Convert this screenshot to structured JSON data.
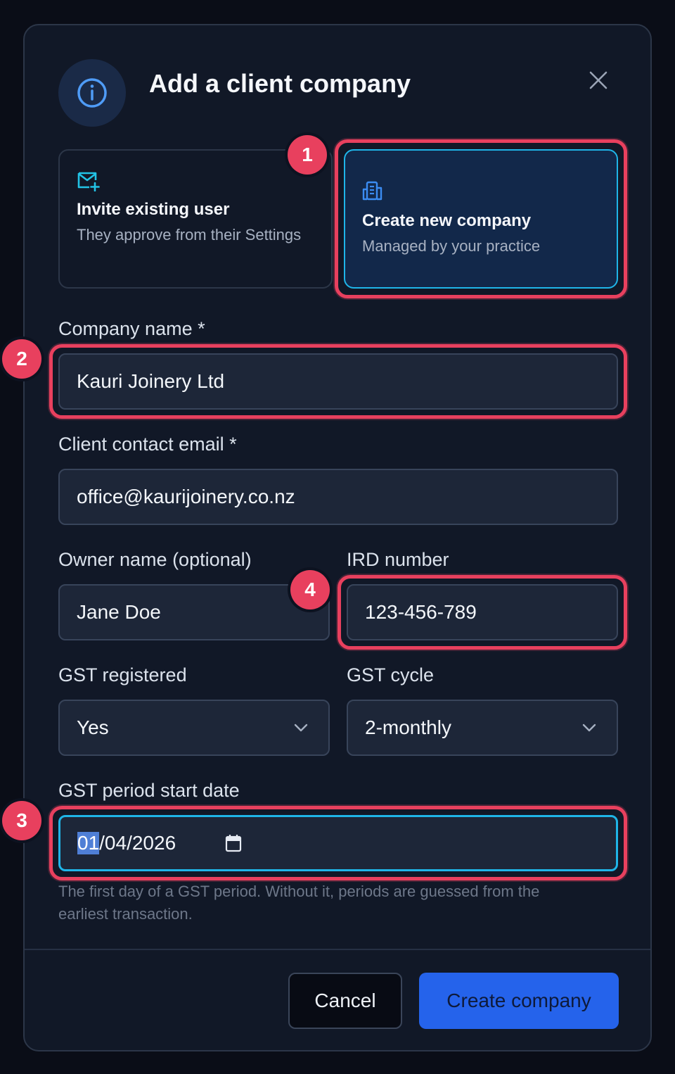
{
  "dialog": {
    "title": "Add a client company",
    "icons": {
      "header": "info-icon",
      "close": "close-icon"
    }
  },
  "options": {
    "invite": {
      "title": "Invite existing user",
      "subtitle": "They approve from their Settings",
      "icon": "mail-plus-icon"
    },
    "create": {
      "title": "Create new company",
      "subtitle": "Managed by your practice",
      "icon": "building-icon",
      "selected": true
    }
  },
  "form": {
    "company_name": {
      "label": "Company name *",
      "value": "Kauri Joinery Ltd"
    },
    "client_email": {
      "label": "Client contact email *",
      "value": "office@kaurijoinery.co.nz"
    },
    "owner_name": {
      "label": "Owner name (optional)",
      "value": "Jane Doe"
    },
    "ird_number": {
      "label": "IRD number",
      "value": "123-456-789"
    },
    "gst_registered": {
      "label": "GST registered",
      "value": "Yes"
    },
    "gst_cycle": {
      "label": "GST cycle",
      "value": "2-monthly"
    },
    "gst_start": {
      "label": "GST period start date",
      "day": "01",
      "rest": "/04/2026",
      "helper": "The first day of a GST period. Without it, periods are guessed from the earliest transaction."
    }
  },
  "actions": {
    "cancel": "Cancel",
    "submit": "Create company"
  },
  "annotations": {
    "badge_1": "1",
    "badge_2": "2",
    "badge_3": "3",
    "badge_4": "4"
  },
  "colors": {
    "accent": "#2563eb",
    "highlight": "#e8405e",
    "focus": "#1fb5e8",
    "modal_bg": "#111827"
  }
}
